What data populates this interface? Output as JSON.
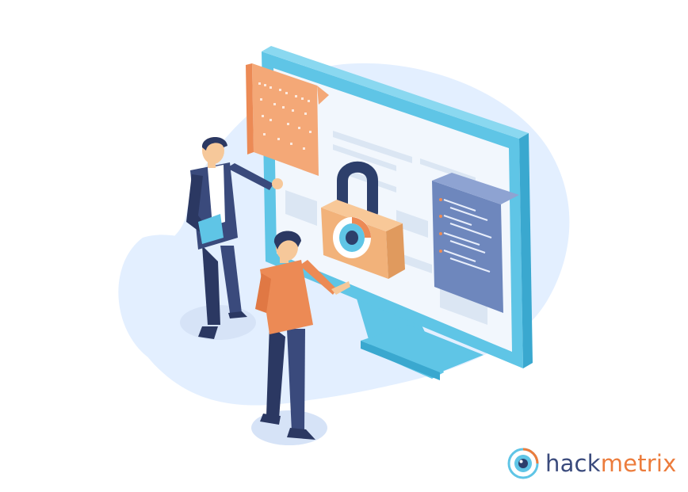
{
  "brand": {
    "part1": "hack",
    "part2": "metrix"
  },
  "colors": {
    "background": "#ffffff",
    "blob": "#e3efff",
    "monitor_frame": "#5fc5e6",
    "monitor_frame_dark": "#3aa8cf",
    "screen": "#f2f7fd",
    "screen_lines": "#dbe6f3",
    "code_panel": "#6e87bd",
    "code_panel_dark": "#5a6fa5",
    "orange": "#ec8a55",
    "orange_light": "#f4a877",
    "lock_body": "#f2b27a",
    "lock_shackle": "#2d3f6b",
    "suit": "#3a4a7c",
    "suit_dark": "#2b3862",
    "skin": "#f6c89a",
    "hair": "#2b3862",
    "shadow": "#d6e3f7",
    "brand_dark": "#3a4a7c",
    "brand_orange": "#ec7c3c"
  },
  "icons": {
    "illustration": "cybersecurity-monitor-illustration",
    "lock": "padlock-eye-icon",
    "logo": "hackmetrix-eye-logo-icon"
  }
}
